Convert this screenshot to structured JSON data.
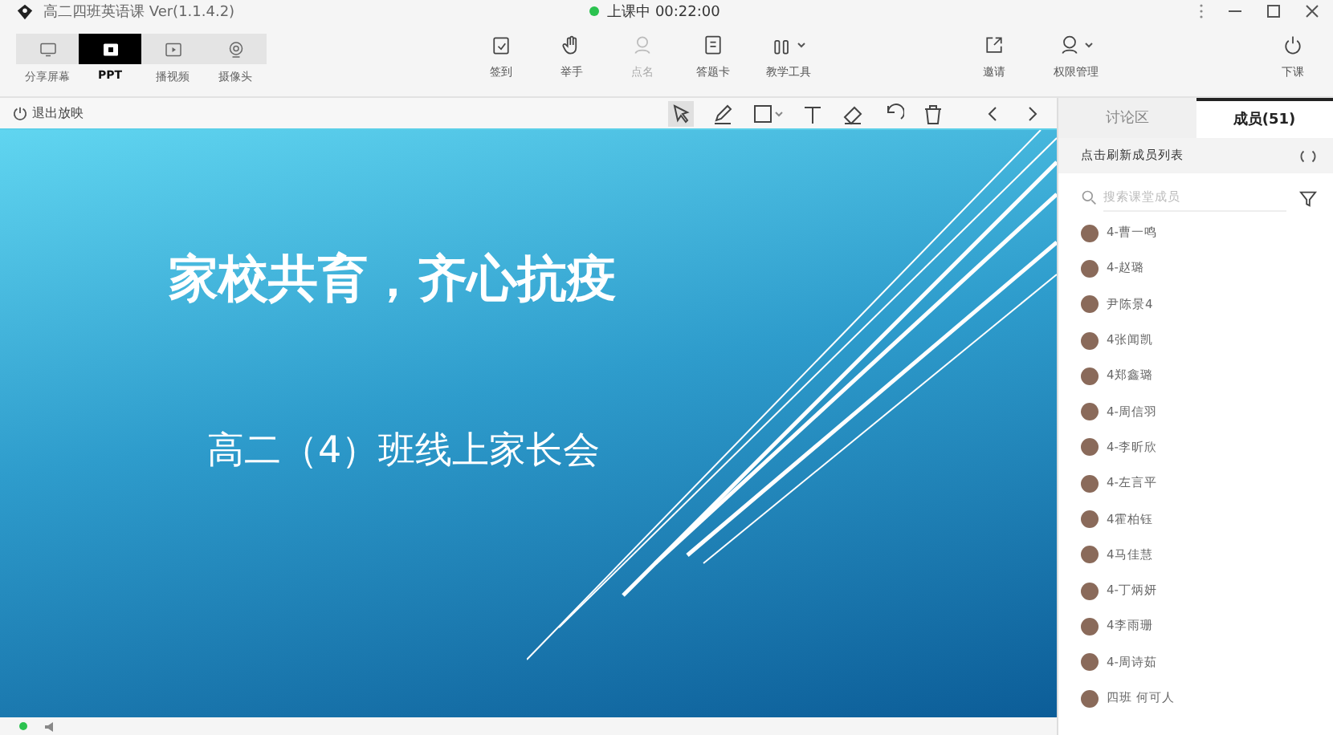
{
  "window": {
    "title": "高二四班英语课 Ver(1.1.4.2)"
  },
  "status": "上课中 00:22:00",
  "mode_tabs": [
    {
      "label": "分享屏幕",
      "selected": false
    },
    {
      "label": "PPT",
      "selected": true
    },
    {
      "label": "播视频",
      "selected": false
    },
    {
      "label": "摄像头",
      "selected": false
    }
  ],
  "tools": [
    {
      "label": "签到",
      "disabled": false,
      "has_menu": false
    },
    {
      "label": "举手",
      "disabled": false,
      "has_menu": false
    },
    {
      "label": "点名",
      "disabled": true,
      "has_menu": false
    },
    {
      "label": "答题卡",
      "disabled": false,
      "has_menu": false
    },
    {
      "label": "教学工具",
      "disabled": false,
      "has_menu": true
    }
  ],
  "right_tools": [
    {
      "label": "邀请",
      "has_menu": false
    },
    {
      "label": "权限管理",
      "has_menu": true
    }
  ],
  "end_button": {
    "label": "下课"
  },
  "exit_button": {
    "label": "退出放映"
  },
  "slide": {
    "title": "家校共育，齐心抗疫",
    "subtitle": "高二（4）班线上家长会"
  },
  "panel_tabs": [
    {
      "label": "讨论区",
      "selected": false
    },
    {
      "label": "成员(51)",
      "selected": true
    }
  ],
  "refresh_label": "点击刷新成员列表",
  "search": {
    "placeholder": "搜索课堂成员"
  },
  "members": [
    {
      "name": "4-曹一鸣"
    },
    {
      "name": "4-赵璐"
    },
    {
      "name": "尹陈景4"
    },
    {
      "name": "4张闻凯"
    },
    {
      "name": "4郑鑫璐"
    },
    {
      "name": "4-周信羽"
    },
    {
      "name": "4-李昕欣"
    },
    {
      "name": "4-左言平"
    },
    {
      "name": "4霍柏钰"
    },
    {
      "name": "4马佳慧"
    },
    {
      "name": "4-丁炳妍"
    },
    {
      "name": "4李雨珊"
    },
    {
      "name": "4-周诗茹"
    },
    {
      "name": "四班 何可人"
    }
  ]
}
